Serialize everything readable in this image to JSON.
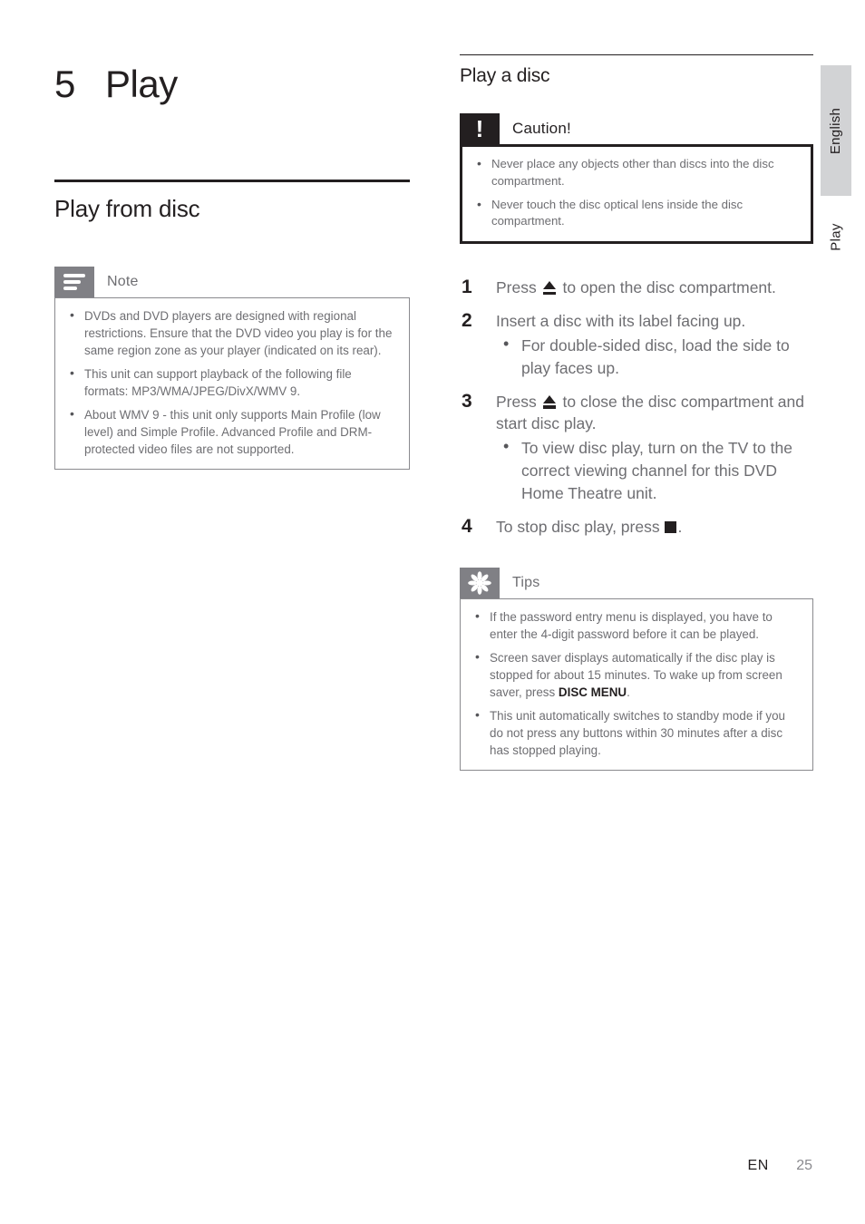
{
  "chapter": {
    "number": "5",
    "title": "Play"
  },
  "left_column": {
    "section_heading": "Play from disc",
    "note_box": {
      "icon": "note-lines-icon",
      "title": "Note",
      "items": [
        "DVDs and DVD players are designed with regional restrictions.  Ensure that the DVD video you play is for the same region zone as your player (indicated on its rear).",
        "This unit can support playback of the following file formats: MP3/WMA/JPEG/DivX/WMV 9.",
        "About WMV 9 - this unit only supports Main Profile (low level) and Simple Profile.  Advanced Profile and DRM-protected video files are not supported."
      ]
    }
  },
  "right_column": {
    "section_heading": "Play a disc",
    "caution_box": {
      "icon": "exclamation-icon",
      "title": "Caution!",
      "items": [
        "Never place any objects other than discs into the disc compartment.",
        "Never touch the disc optical lens inside the disc compartment."
      ]
    },
    "steps": [
      {
        "number": "1",
        "text_before": "Press",
        "glyph": "eject-icon",
        "text_after": "to open the disc compartment.",
        "substeps": []
      },
      {
        "number": "2",
        "text_before": "Insert a disc with its label facing up.",
        "glyph": "",
        "text_after": "",
        "substeps": [
          "For double-sided disc, load the side to play faces up."
        ]
      },
      {
        "number": "3",
        "text_before": "Press",
        "glyph": "eject-icon",
        "text_after": "to close the disc compartment and start disc play.",
        "substeps": [
          "To view disc play, turn on the TV to the correct viewing channel for this DVD Home Theatre unit."
        ]
      },
      {
        "number": "4",
        "text_before": "To stop disc play, press",
        "glyph": "stop-icon",
        "text_after": ".",
        "substeps": []
      }
    ],
    "tips_box": {
      "icon": "asterisk-icon",
      "title": "Tips",
      "items": [
        {
          "lead": "If the password entry menu is displayed, you have to enter the 4-digit password before it can be played.",
          "bold": "",
          "tail": ""
        },
        {
          "lead": "Screen saver displays automatically if the disc play is stopped for about 15 minutes. To wake up from screen saver, press ",
          "bold": "DISC MENU",
          "tail": "."
        },
        {
          "lead": "This unit automatically switches to standby mode if you do not press any buttons within 30 minutes after a disc has stopped playing.",
          "bold": "",
          "tail": ""
        }
      ]
    }
  },
  "side_tabs": {
    "language_tab": "English",
    "chapter_tab": "Play"
  },
  "footer": {
    "language_code": "EN",
    "page_number": "25"
  },
  "colors": {
    "text_body": "#6e6e72",
    "text_dark": "#231f20",
    "icon_gray": "#808085",
    "icon_black": "#231f20",
    "tab_gray": "#d2d3d5"
  }
}
